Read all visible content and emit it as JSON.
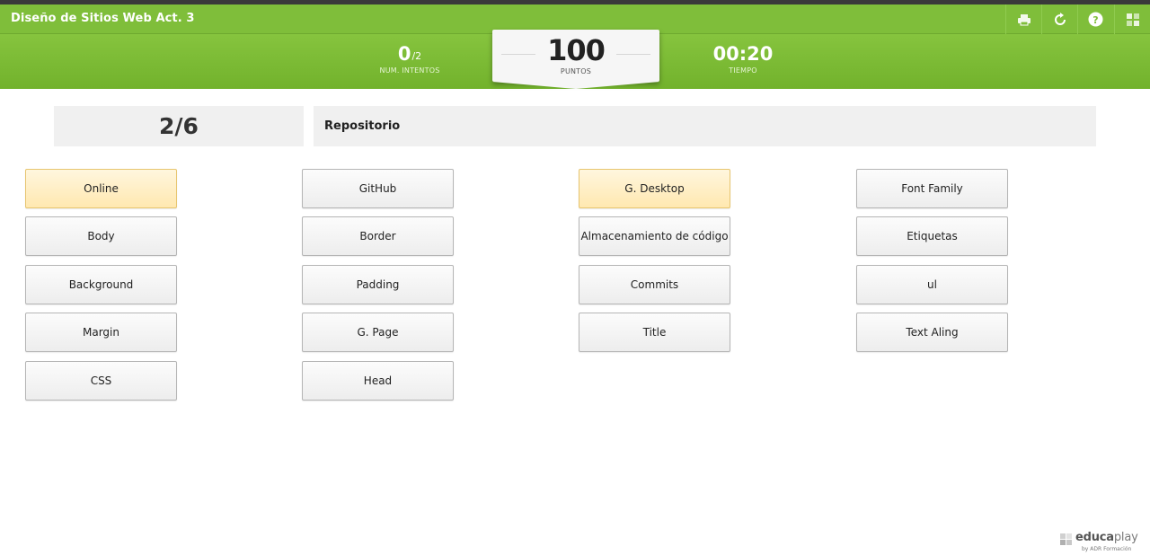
{
  "app": {
    "title": "Diseño de Sitios Web Act. 3"
  },
  "toolbar": [
    {
      "name": "print-icon"
    },
    {
      "name": "restart-icon"
    },
    {
      "name": "help-icon"
    },
    {
      "name": "grid-icon"
    }
  ],
  "colors": {
    "brand_green": "#7fbe3a",
    "selected_fill": "#ffe8b0",
    "button_fill": "#ededed"
  },
  "scoreboard": {
    "attempts": "0",
    "attempts_total": "/2",
    "attempts_label": "NUM. INTENTOS",
    "points": "100",
    "points_label": "PUNTOS",
    "time": "00:20",
    "time_label": "TIEMPO"
  },
  "question": {
    "counter": "2/6",
    "prompt": "Repositorio"
  },
  "columns": [
    [
      {
        "label": "Online",
        "selected": true
      },
      {
        "label": "Body",
        "selected": false
      },
      {
        "label": "Background",
        "selected": false
      },
      {
        "label": "Margin",
        "selected": false
      },
      {
        "label": "CSS",
        "selected": false
      }
    ],
    [
      {
        "label": "GitHub",
        "selected": false
      },
      {
        "label": "Border",
        "selected": false
      },
      {
        "label": "Padding",
        "selected": false
      },
      {
        "label": "G. Page",
        "selected": false
      },
      {
        "label": "Head",
        "selected": false
      }
    ],
    [
      {
        "label": "G. Desktop",
        "selected": true
      },
      {
        "label": "Almacenamiento de código",
        "selected": false
      },
      {
        "label": "Commits",
        "selected": false
      },
      {
        "label": "Title",
        "selected": false
      }
    ],
    [
      {
        "label": "Font Family",
        "selected": false
      },
      {
        "label": "Etiquetas",
        "selected": false
      },
      {
        "label": "ul",
        "selected": false
      },
      {
        "label": "Text Aling",
        "selected": false
      }
    ]
  ],
  "footer": {
    "brand_a": "educa",
    "brand_b": "play",
    "byline": "by ADR Formación"
  }
}
